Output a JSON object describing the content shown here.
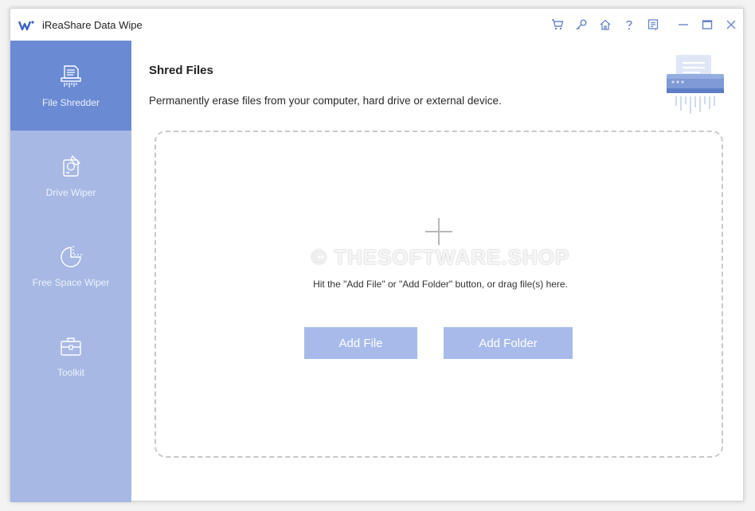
{
  "window": {
    "title": "iReaShare Data Wipe"
  },
  "titlebar_icons": [
    "cart-icon",
    "key-icon",
    "home-icon",
    "help-icon",
    "feedback-icon",
    "minimize-icon",
    "maximize-icon",
    "close-icon"
  ],
  "sidebar": {
    "items": [
      {
        "label": "File Shredder",
        "icon": "shredder-icon",
        "active": true
      },
      {
        "label": "Drive Wiper",
        "icon": "drive-icon",
        "active": false
      },
      {
        "label": "Free Space Wiper",
        "icon": "pie-chart-icon",
        "active": false
      },
      {
        "label": "Toolkit",
        "icon": "toolbox-icon",
        "active": false
      }
    ]
  },
  "main": {
    "title": "Shred Files",
    "description": "Permanently erase files from your computer, hard drive or external device.",
    "dropzone": {
      "hint": "Hit the \"Add File\" or \"Add Folder\" button, or drag file(s) here.",
      "watermark": "© THESOFTWARE.SHOP"
    },
    "buttons": {
      "add_file": "Add File",
      "add_folder": "Add Folder"
    }
  },
  "colors": {
    "sidebar_bg": "#a6b8e3",
    "sidebar_active": "#6a8bd3",
    "button_bg": "#a8baea",
    "icon_accent": "#6a86c9"
  }
}
